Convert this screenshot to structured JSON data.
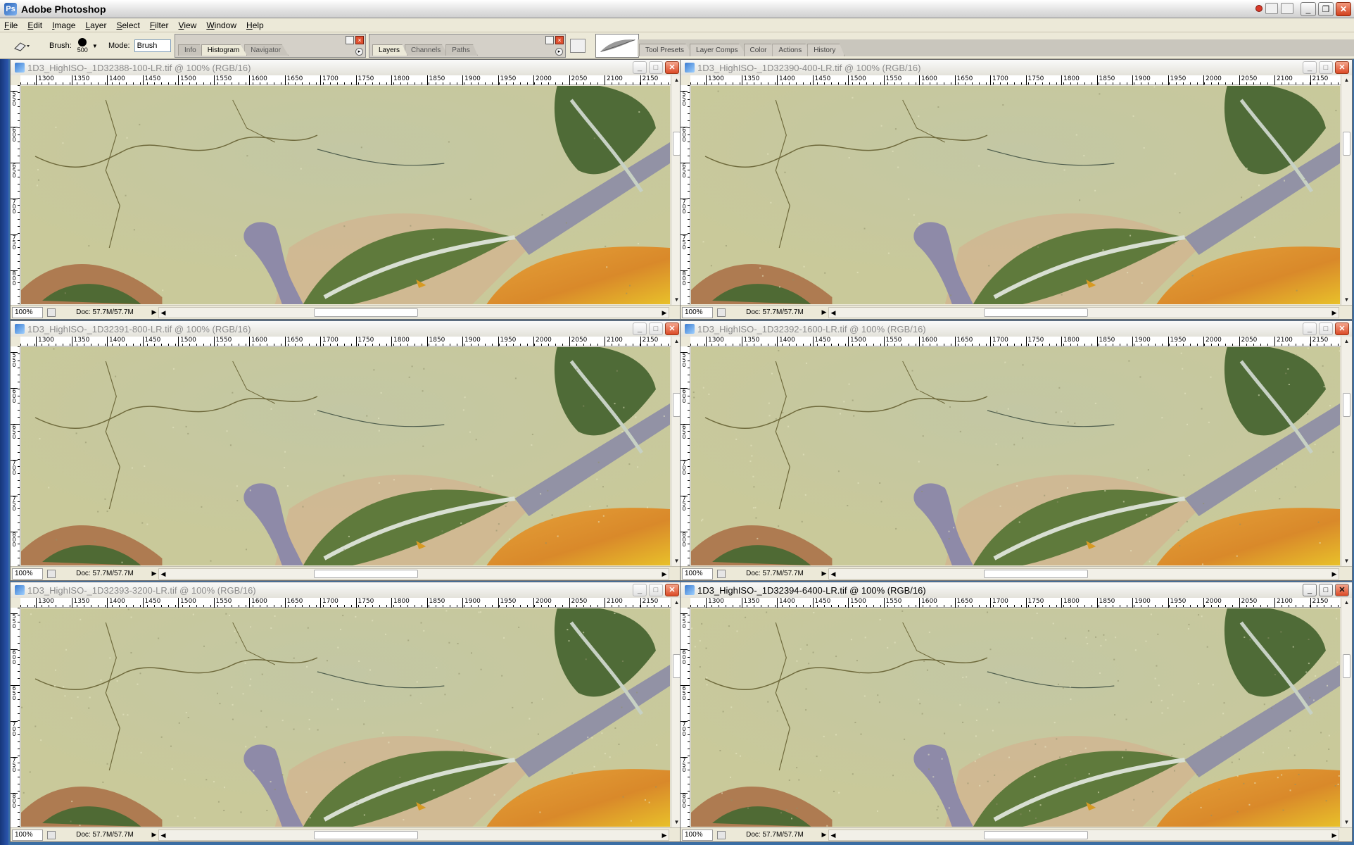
{
  "app": {
    "title": "Adobe Photoshop"
  },
  "menu": [
    "File",
    "Edit",
    "Image",
    "Layer",
    "Select",
    "Filter",
    "View",
    "Window",
    "Help"
  ],
  "options": {
    "brush_label": "Brush:",
    "brush_size": "500",
    "mode_label": "Mode:",
    "mode_value": "Brush",
    "palette_group_1": [
      "Info",
      "Histogram",
      "Navigator"
    ],
    "palette_group_2": [
      "Layers",
      "Channels",
      "Paths"
    ],
    "palette_well_tabs": [
      "Tool Presets",
      "Layer Comps",
      "Color",
      "Actions",
      "History"
    ]
  },
  "ruler": {
    "h_labels": [
      "1300",
      "1350",
      "1400",
      "1450",
      "1500",
      "1550",
      "1600",
      "1650",
      "1700",
      "1750",
      "1800",
      "1850",
      "1900",
      "1950",
      "2000",
      "2050",
      "2100",
      "2150"
    ],
    "v_labels": [
      "550",
      "600",
      "650",
      "700",
      "750",
      "800"
    ]
  },
  "documents": [
    {
      "title": "1D3_HighISO-_1D32388-100-LR.tif @ 100% (RGB/16)",
      "zoom": "100%",
      "doc": "Doc: 57.7M/57.7M",
      "active": false,
      "iso_noise": 0.05
    },
    {
      "title": "1D3_HighISO-_1D32390-400-LR.tif @ 100% (RGB/16)",
      "zoom": "100%",
      "doc": "Doc: 57.7M/57.7M",
      "active": false,
      "iso_noise": 0.1
    },
    {
      "title": "1D3_HighISO-_1D32391-800-LR.tif @ 100% (RGB/16)",
      "zoom": "100%",
      "doc": "Doc: 57.7M/57.7M",
      "active": false,
      "iso_noise": 0.15
    },
    {
      "title": "1D3_HighISO-_1D32392-1600-LR.tif @ 100% (RGB/16)",
      "zoom": "100%",
      "doc": "Doc: 57.7M/57.7M",
      "active": false,
      "iso_noise": 0.2
    },
    {
      "title": "1D3_HighISO-_1D32393-3200-LR.tif @ 100% (RGB/16)",
      "zoom": "100%",
      "doc": "Doc: 57.7M/57.7M",
      "active": false,
      "iso_noise": 0.28
    },
    {
      "title": "1D3_HighISO-_1D32394-6400-LR.tif @ 100% (RGB/16)",
      "zoom": "100%",
      "doc": "Doc: 57.7M/57.7M",
      "active": true,
      "iso_noise": 0.36
    }
  ],
  "colors": {
    "canvas_bg": "#c9c99a",
    "leaf": "#5f7a3c",
    "orange": "#d9892a",
    "crack": "#6f6a3c"
  }
}
